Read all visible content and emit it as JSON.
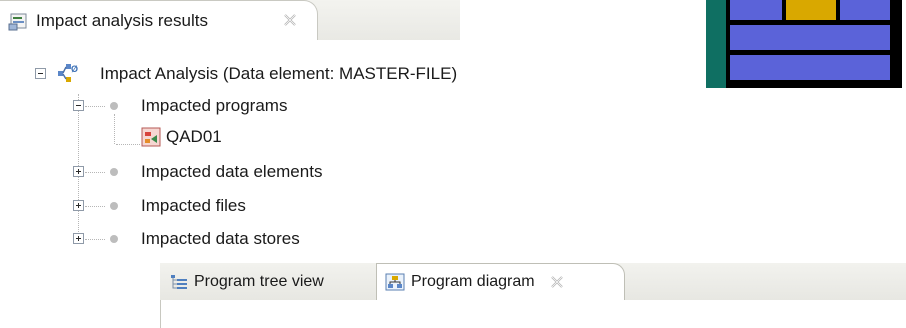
{
  "view_tab": {
    "title": "Impact analysis results"
  },
  "tree": {
    "root": "Impact Analysis (Data element: MASTER-FILE)",
    "groups": [
      {
        "label": "Impacted programs",
        "expanded": true,
        "children": [
          "QAD01"
        ]
      },
      {
        "label": "Impacted data elements",
        "expanded": false
      },
      {
        "label": "Impacted files",
        "expanded": false
      },
      {
        "label": "Impacted data stores",
        "expanded": false
      }
    ]
  },
  "editor_tabs": [
    {
      "label": "Program tree view",
      "active": false
    },
    {
      "label": "Program diagram",
      "active": true
    }
  ],
  "colors": {
    "logo_blue": "#5b63d9",
    "logo_gold": "#d9a800",
    "logo_teal": "#0f6f62",
    "program_icon": "#d7443c"
  }
}
